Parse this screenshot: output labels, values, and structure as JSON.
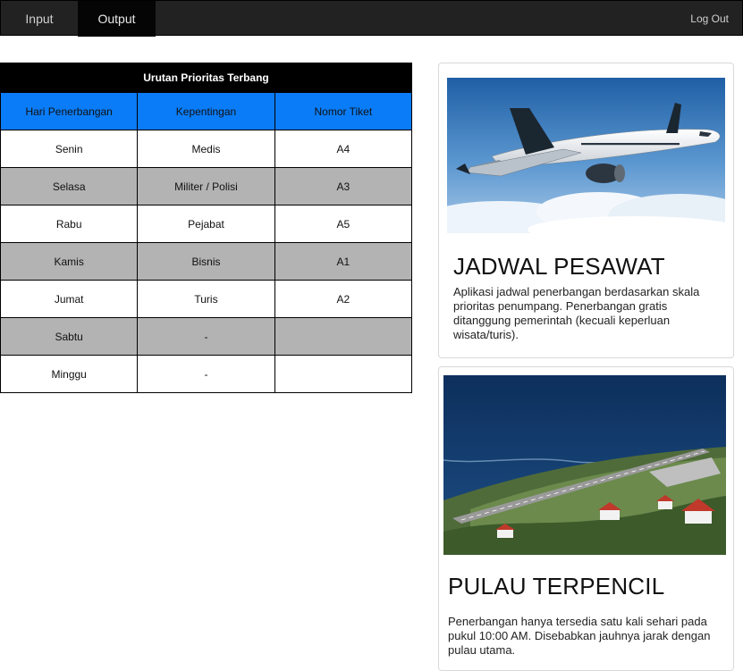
{
  "nav": {
    "tabs": [
      {
        "label": "Input",
        "active": false
      },
      {
        "label": "Output",
        "active": true
      }
    ],
    "logout_label": "Log Out"
  },
  "table": {
    "title": "Urutan Prioritas Terbang",
    "headers": [
      "Hari Penerbangan",
      "Kepentingan",
      "Nomor Tiket"
    ],
    "rows": [
      [
        "Senin",
        "Medis",
        "A4"
      ],
      [
        "Selasa",
        "Militer / Polisi",
        "A3"
      ],
      [
        "Rabu",
        "Pejabat",
        "A5"
      ],
      [
        "Kamis",
        "Bisnis",
        "A1"
      ],
      [
        "Jumat",
        "Turis",
        "A2"
      ],
      [
        "Sabtu",
        "-",
        ""
      ],
      [
        "Minggu",
        "-",
        ""
      ]
    ]
  },
  "cards": [
    {
      "title": "JADWAL PESAWAT",
      "text": "Aplikasi jadwal penerbangan berdasarkan skala prioritas penumpang. Penerbangan gratis ditanggung pemerintah (kecuali keperluan wisata/turis)."
    },
    {
      "title": "PULAU TERPENCIL",
      "text": "Penerbangan hanya tersedia satu kali sehari pada pukul 10:00 AM. Disebabkan jauhnya jarak dengan pulau utama."
    }
  ],
  "colors": {
    "navbar": "#222222",
    "table_header": "#0a7cf8",
    "row_alt": "#b3b3b3"
  }
}
